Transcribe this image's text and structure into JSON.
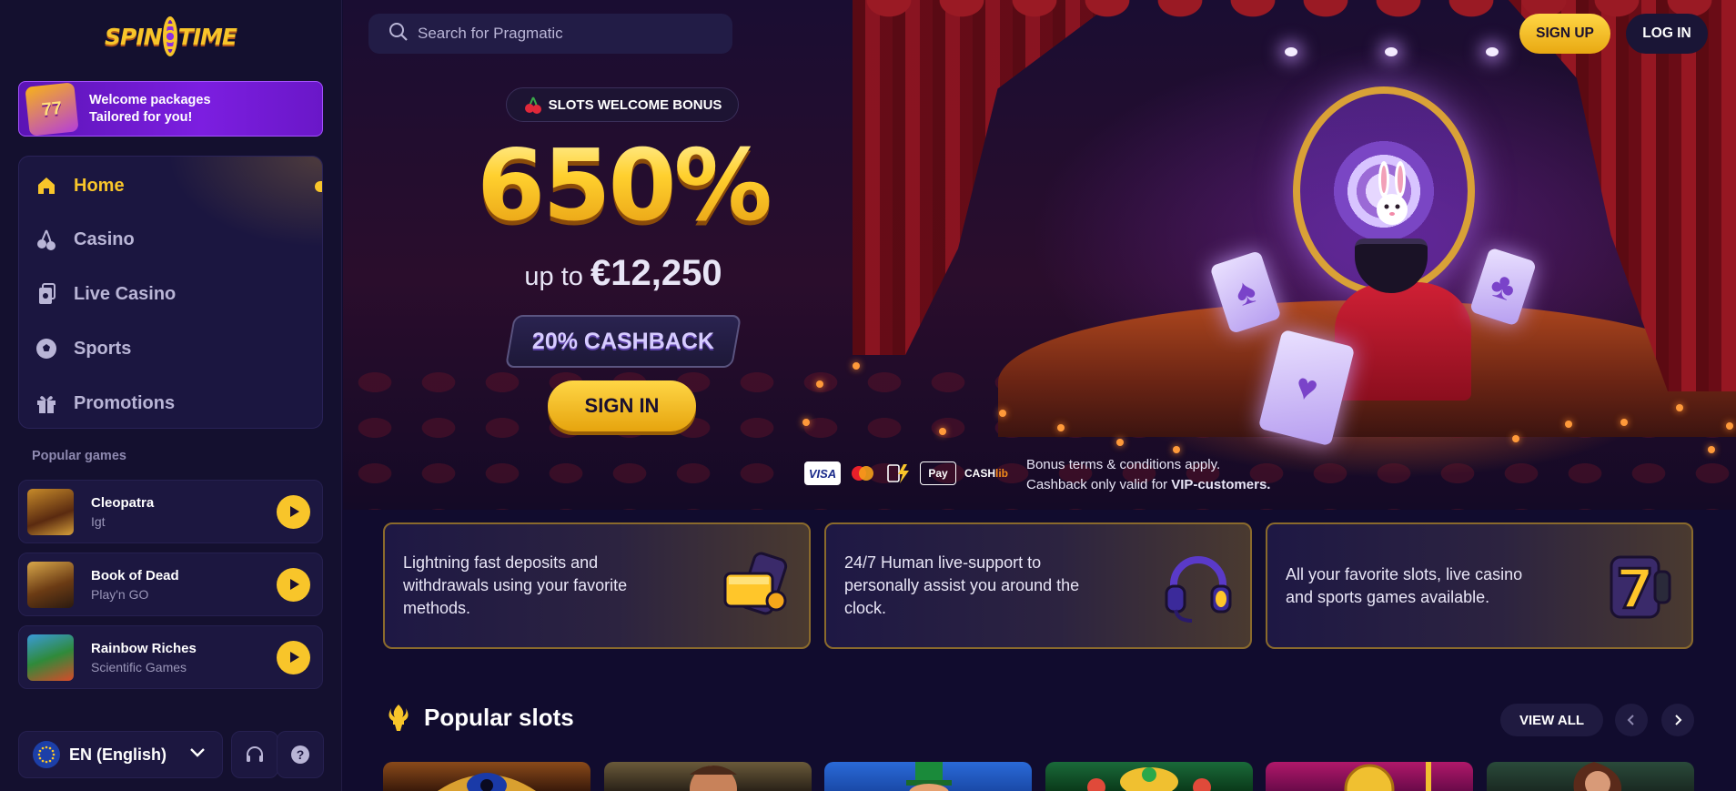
{
  "brand": {
    "logo_text_left": "SPIN",
    "logo_text_right": "TIME"
  },
  "sidebar": {
    "welcome": {
      "line1": "Welcome packages",
      "line2": "Tailored for you!",
      "icon": "slot-seven-icon"
    },
    "nav": [
      {
        "label": "Home",
        "icon": "home-icon",
        "active": true
      },
      {
        "label": "Casino",
        "icon": "cherries-icon",
        "active": false
      },
      {
        "label": "Live Casino",
        "icon": "cards-icon",
        "active": false
      },
      {
        "label": "Sports",
        "icon": "soccer-ball-icon",
        "active": false
      },
      {
        "label": "Promotions",
        "icon": "gift-icon",
        "active": false
      }
    ],
    "popular_title": "Popular games",
    "games": [
      {
        "name": "Cleopatra",
        "provider": "Igt"
      },
      {
        "name": "Book of Dead",
        "provider": "Play'n GO"
      },
      {
        "name": "Rainbow Riches",
        "provider": "Scientific Games"
      }
    ],
    "language": "EN (English)"
  },
  "header": {
    "search_placeholder": "Search for Pragmatic",
    "signup": "SIGN UP",
    "login": "LOG IN"
  },
  "hero": {
    "tag": "SLOTS WELCOME BONUS",
    "percent": "650%",
    "upto_prefix": "up to",
    "upto_amount": "€12,250",
    "cashback": "20% CASHBACK",
    "signin": "SIGN IN",
    "payments": [
      "VISA",
      "Mastercard",
      "Instant",
      "Apple Pay",
      "CASHlib"
    ],
    "terms_line1": "Bonus terms & conditions apply.",
    "terms_line2_prefix": "Cashback only valid for",
    "terms_line2_bold": "VIP-customers."
  },
  "features": [
    {
      "text": "Lightning fast deposits and withdrawals using your favorite methods.",
      "icon": "wallet-phone-icon"
    },
    {
      "text": "24/7 Human live-support to personally assist you around the clock.",
      "icon": "headset-icon"
    },
    {
      "text": "All your favorite slots, live casino and sports games available.",
      "icon": "slot-seven-icon"
    }
  ],
  "popular_slots": {
    "title": "Popular slots",
    "view_all": "VIEW ALL"
  },
  "colors": {
    "accent": "#f8c52a",
    "bg": "#110c2e",
    "sidebar": "#14102f"
  }
}
